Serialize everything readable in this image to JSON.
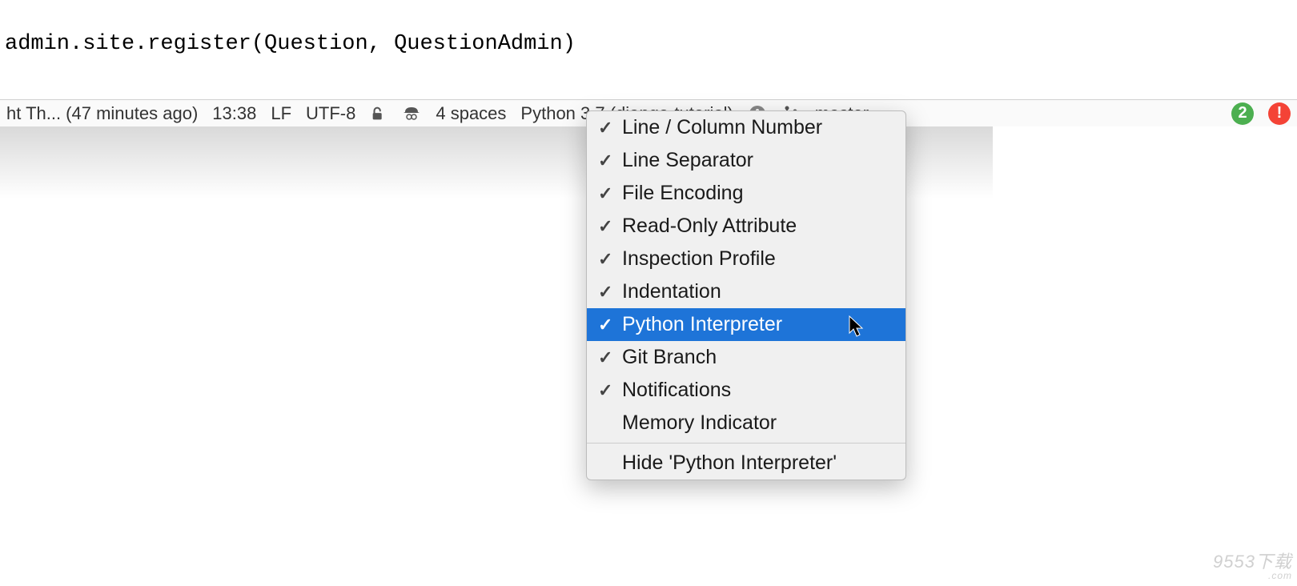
{
  "editor": {
    "code_line": "admin.site.register(Question, QuestionAdmin)"
  },
  "status_bar": {
    "commit_info": "ht Th... (47 minutes ago)",
    "time": "13:38",
    "line_separator": "LF",
    "encoding": "UTF-8",
    "indent": "4 spaces",
    "interpreter": "Python 3.7 (django-tutorial)",
    "branch": "master",
    "badge_green": "2",
    "badge_red": "!"
  },
  "menu": {
    "items": [
      {
        "label": "Line / Column Number",
        "checked": true,
        "selected": false
      },
      {
        "label": "Line Separator",
        "checked": true,
        "selected": false
      },
      {
        "label": "File Encoding",
        "checked": true,
        "selected": false
      },
      {
        "label": "Read-Only Attribute",
        "checked": true,
        "selected": false
      },
      {
        "label": "Inspection Profile",
        "checked": true,
        "selected": false
      },
      {
        "label": "Indentation",
        "checked": true,
        "selected": false
      },
      {
        "label": "Python Interpreter",
        "checked": true,
        "selected": true
      },
      {
        "label": "Git Branch",
        "checked": true,
        "selected": false
      },
      {
        "label": "Notifications",
        "checked": true,
        "selected": false
      },
      {
        "label": "Memory Indicator",
        "checked": false,
        "selected": false
      }
    ],
    "hide_label": "Hide 'Python Interpreter'"
  },
  "watermark": {
    "text": "9553下载",
    "subtext": ".com"
  }
}
